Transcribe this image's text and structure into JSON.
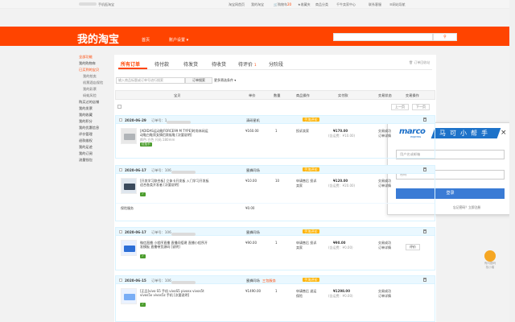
{
  "topbar": {
    "user": "",
    "mobile": "手机逛淘宝",
    "home": "淘宝网首页",
    "my_taobao": "我的淘宝",
    "cart": "购物车",
    "cart_count": "20",
    "favorites": "收藏夹",
    "goods": "商品分类",
    "seller": "千牛卖家中心",
    "contact": "联系客服",
    "sitemap": "网站导航"
  },
  "header": {
    "logo": "我的淘宝",
    "nav_home": "首页",
    "nav_account": "账户设置"
  },
  "sidebar": {
    "items": [
      {
        "label": "全部功能",
        "cls": "hot"
      },
      {
        "label": "我的购物车",
        "cls": ""
      },
      {
        "label": "已买到的宝贝",
        "cls": "hot"
      },
      {
        "label": "我的拍卖",
        "cls": "sub"
      },
      {
        "label": "机票酒店保险",
        "cls": "sub"
      },
      {
        "label": "我的彩票",
        "cls": "sub"
      },
      {
        "label": "蚂蚁风险",
        "cls": "sub"
      },
      {
        "label": "购买过的店铺",
        "cls": ""
      },
      {
        "label": "我的发票",
        "cls": ""
      },
      {
        "label": "我的收藏",
        "cls": ""
      },
      {
        "label": "我的积分",
        "cls": ""
      },
      {
        "label": "我的优惠信息",
        "cls": ""
      },
      {
        "label": "评价管理",
        "cls": ""
      },
      {
        "label": "退款维权",
        "cls": ""
      },
      {
        "label": "我的足迹",
        "cls": ""
      },
      {
        "label": "我的订阅",
        "cls": ""
      },
      {
        "label": "流量钱包",
        "cls": ""
      }
    ]
  },
  "tabs": [
    {
      "label": "所有订单",
      "active": true
    },
    {
      "label": "待付款",
      "active": false
    },
    {
      "label": "待发货",
      "active": false
    },
    {
      "label": "待收货",
      "active": false
    },
    {
      "label": "待评价",
      "active": false,
      "count": "1"
    },
    {
      "label": "分阶段",
      "active": false
    }
  ],
  "recycle_link": "订单回收站",
  "order_search": {
    "placeholder": "输入商品标题或订单号进行搜索",
    "button": "订单搜索",
    "more": "更多筛选条件"
  },
  "table_header": [
    "宝贝",
    "单价",
    "数量",
    "商品操作",
    "实付款",
    "交易状态",
    "交易操作"
  ],
  "pager": {
    "prev": "上一页",
    "next": "下一页"
  },
  "orders": [
    {
      "date": "2020-06-29",
      "no_label": "订单号：1",
      "shop": "清研星机",
      "title": "[ADIDAS运动鞋FORCE99 M TYPE]时尚休闲运动鞋白鞋男女情侣款板鞋 [次要说明]",
      "spec": "颜色:白色 尺码:180mm",
      "price": "¥160.00",
      "qty": "1",
      "op": "投诉卖家",
      "paid": "¥170.00",
      "paid_note": "(含运费：¥10.00)",
      "status": "交易成功",
      "detail": "订单详情",
      "extra": "",
      "extra_price": "",
      "badge": "手淘评价",
      "tag": "红包卡"
    },
    {
      "date": "2020-06-17",
      "no_label": "订单号：106",
      "shop": "蜜蜂同场",
      "title": "[开发学习联合板] 立体卡开发板 入门学习开发板 适合各类开发者 [次要说明]",
      "spec": "",
      "price": "¥10.00",
      "qty": "10",
      "op": "申请售后 投诉卖家",
      "paid": "¥120.00",
      "paid_note": "(含运费：¥20.00)",
      "status": "交易成功",
      "detail": "订单详情",
      "extra": "保险服务",
      "extra_price": "¥0.00",
      "badge": "手淘评价",
      "tag": ""
    },
    {
      "date": "2020-06-17",
      "no_label": "订单号：106",
      "shop": "蜜蜂同场",
      "title": "微信直播 小程序直播 直播间搭建 直播小程序开发模板 直播带货源码 [说明]",
      "spec": "",
      "price": "¥90.00",
      "qty": "1",
      "op": "申请售后 投诉卖家",
      "paid": "¥90.00",
      "paid_note": "(含运费：¥0.00)",
      "status": "交易成功",
      "detail": "订单详情",
      "extra": "",
      "extra_price": "",
      "badge": "手淘评价",
      "tag": "",
      "action": "评价"
    },
    {
      "date": "2020-06-15",
      "no_label": "订单号：106",
      "shop": "蜜蜂同场",
      "title": "[正品]vivo S5 手机 vivoS5 pivosx vivos5t vivos5x vivos5z 手机 [次要说明]",
      "spec": "",
      "price": "¥1490.00",
      "qty": "1",
      "op": "申请售后 退运保险",
      "paid": "¥1298.00",
      "paid_note": "(含运费：¥0.00)",
      "status": "交易成功",
      "detail": "订单详情",
      "extra": "",
      "extra_price": "",
      "badge": "手淘评价",
      "tag": "",
      "seller_badge": "三包服务"
    }
  ],
  "helper_panel": {
    "brand": "marco",
    "brand_sub": "express",
    "title": "马可小帮手",
    "close": "×",
    "username_placeholder": "用户名或邮箱",
    "password_placeholder": "密码",
    "login": "登录",
    "forgot": "忘记密码？立即注册"
  },
  "float_helper": {
    "label1": "有问题吗",
    "label2": "找小蜜"
  }
}
